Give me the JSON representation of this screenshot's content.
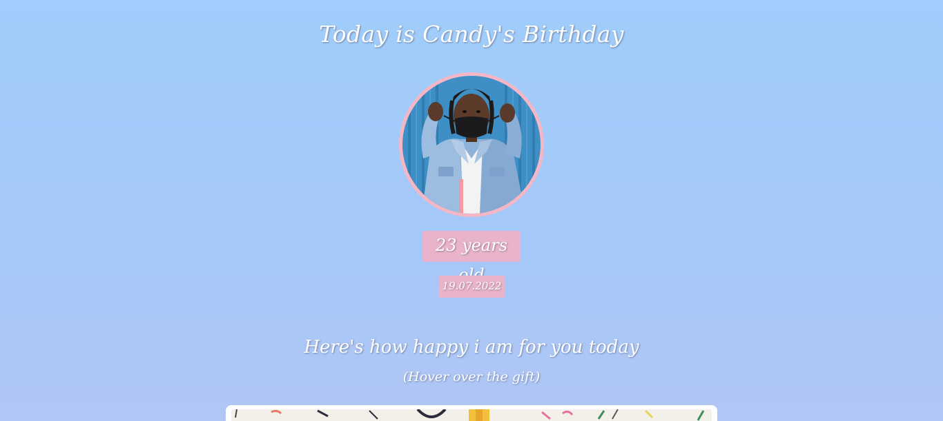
{
  "page": {
    "title": "Today is Candy's Birthday",
    "age_label": "23 years old",
    "date_label": "19.07.2022",
    "happy_message": "Here's how happy i am for you today",
    "hover_hint": "(Hover over the gift)"
  },
  "avatar": {
    "icon": "portrait-photo-icon"
  },
  "gift": {
    "icon": "gift-box-icon"
  },
  "colors": {
    "background_top": "#a0cdfb",
    "background_bottom": "#b1c6f4",
    "badge_pink": "#e8b3cb",
    "avatar_ring": "#f5b6c6",
    "text": "#ffffff"
  }
}
